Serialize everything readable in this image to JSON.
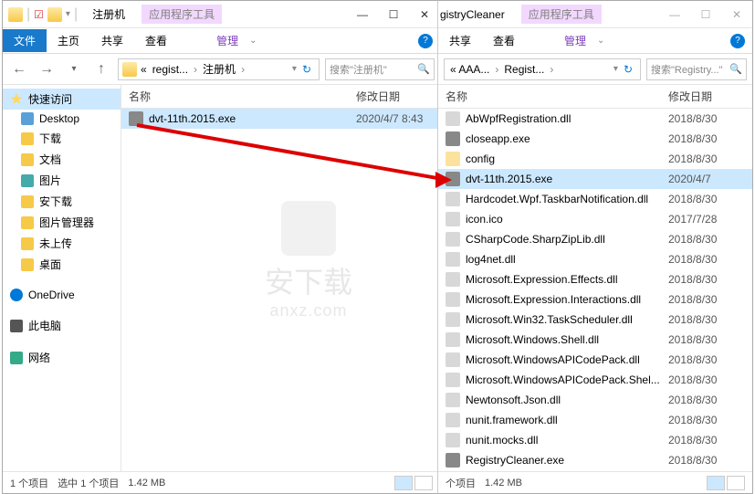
{
  "win1": {
    "title": "注册机",
    "tool_tab": "应用程序工具",
    "ribbon": {
      "file": "文件",
      "home": "主页",
      "share": "共享",
      "view": "查看",
      "manage": "管理"
    },
    "nav": {
      "refresh": "↻"
    },
    "crumbs": [
      "« ",
      "regist...",
      "注册机"
    ],
    "search_placeholder": "搜索\"注册机\"",
    "columns": {
      "name": "名称",
      "date": "修改日期"
    },
    "files": [
      {
        "name": "dvt-11th.2015.exe",
        "date": "2020/4/7 8:43",
        "type": "exe",
        "selected": true
      }
    ],
    "sidebar": {
      "quick": "快速访问",
      "items": [
        "Desktop",
        "下载",
        "文档",
        "图片",
        "安下载",
        "图片管理器",
        "未上传",
        "桌面"
      ],
      "onedrive": "OneDrive",
      "thispc": "此电脑",
      "network": "网络"
    },
    "status": {
      "count": "1 个项目",
      "selected": "选中 1 个项目",
      "size": "1.42 MB"
    }
  },
  "win2": {
    "title_partial": "gistryCleaner",
    "tool_tab": "应用程序工具",
    "ribbon": {
      "share": "共享",
      "view": "查看",
      "manage": "管理"
    },
    "crumbs": [
      "« AAA...",
      "Regist..."
    ],
    "search_placeholder": "搜索\"Registry...\"",
    "columns": {
      "name": "名称",
      "date": "修改日期"
    },
    "files": [
      {
        "name": "AbWpfRegistration.dll",
        "date": "2018/8/30",
        "type": "dll"
      },
      {
        "name": "closeapp.exe",
        "date": "2018/8/30",
        "type": "exe"
      },
      {
        "name": "config",
        "date": "2018/8/30",
        "type": "fld"
      },
      {
        "name": "dvt-11th.2015.exe",
        "date": "2020/4/7",
        "type": "exe",
        "selected": true
      },
      {
        "name": "Hardcodet.Wpf.TaskbarNotification.dll",
        "date": "2018/8/30",
        "type": "dll"
      },
      {
        "name": "icon.ico",
        "date": "2017/7/28",
        "type": "dll"
      },
      {
        "name": "CSharpCode.SharpZipLib.dll",
        "date": "2018/8/30",
        "type": "dll"
      },
      {
        "name": "log4net.dll",
        "date": "2018/8/30",
        "type": "dll"
      },
      {
        "name": "Microsoft.Expression.Effects.dll",
        "date": "2018/8/30",
        "type": "dll"
      },
      {
        "name": "Microsoft.Expression.Interactions.dll",
        "date": "2018/8/30",
        "type": "dll"
      },
      {
        "name": "Microsoft.Win32.TaskScheduler.dll",
        "date": "2018/8/30",
        "type": "dll"
      },
      {
        "name": "Microsoft.Windows.Shell.dll",
        "date": "2018/8/30",
        "type": "dll"
      },
      {
        "name": "Microsoft.WindowsAPICodePack.dll",
        "date": "2018/8/30",
        "type": "dll"
      },
      {
        "name": "Microsoft.WindowsAPICodePack.Shel...",
        "date": "2018/8/30",
        "type": "dll"
      },
      {
        "name": "Newtonsoft.Json.dll",
        "date": "2018/8/30",
        "type": "dll"
      },
      {
        "name": "nunit.framework.dll",
        "date": "2018/8/30",
        "type": "dll"
      },
      {
        "name": "nunit.mocks.dll",
        "date": "2018/8/30",
        "type": "dll"
      },
      {
        "name": "RegistryCleaner.exe",
        "date": "2018/8/30",
        "type": "exe"
      }
    ],
    "status": {
      "count": "个项目",
      "size": "1.42 MB"
    }
  },
  "watermark": {
    "main": "安下载",
    "sub": "anxz.com"
  }
}
